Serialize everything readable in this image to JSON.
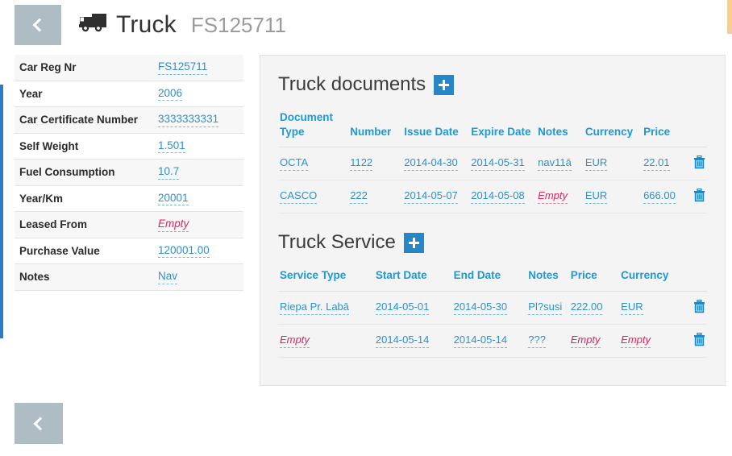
{
  "header": {
    "back_label": "",
    "back_icon": "chevron-left-icon",
    "truck_icon": "truck-icon",
    "title": "Truck",
    "subtitle": "FS125711"
  },
  "colors": {
    "accent_blue": "#2686c8",
    "header_link_blue": "#1a9ad9",
    "value_blue": "#2f8fd0",
    "empty_red": "#e0245e",
    "back_button_gray": "#aebcc4",
    "panel_bg": "#f4f4f4",
    "rail_blue": "#2b7cc4",
    "marker_orange": "#f6cf95"
  },
  "details": {
    "rows": [
      {
        "label": "Car Reg Nr",
        "value": "FS125711",
        "empty": false
      },
      {
        "label": "Year",
        "value": "2006",
        "empty": false
      },
      {
        "label": "Car Certificate Number",
        "value": "3333333331",
        "empty": false
      },
      {
        "label": "Self Weight",
        "value": "1.501",
        "empty": false
      },
      {
        "label": "Fuel Consumption",
        "value": "10.7",
        "empty": false
      },
      {
        "label": "Year/Km",
        "value": "20001",
        "empty": false
      },
      {
        "label": "Leased From",
        "value": "Empty",
        "empty": true
      },
      {
        "label": "Purchase Value",
        "value": "120001.00",
        "empty": false
      },
      {
        "label": "Notes",
        "value": "Nav",
        "empty": false
      }
    ]
  },
  "documents": {
    "title": "Truck documents",
    "add_label": "+",
    "columns": [
      "Document Type",
      "Number",
      "Issue Date",
      "Expire Date",
      "Notes",
      "Currency",
      "Price"
    ],
    "rows": [
      {
        "cells": [
          {
            "text": "OCTA",
            "empty": false
          },
          {
            "text": "1122",
            "empty": false
          },
          {
            "text": "2014-04-30",
            "empty": false
          },
          {
            "text": "2014-05-31",
            "empty": false
          },
          {
            "text": "nav11ā",
            "empty": false
          },
          {
            "text": "EUR",
            "empty": false
          },
          {
            "text": "22.01",
            "empty": false
          }
        ],
        "delete_icon": "trash-icon"
      },
      {
        "cells": [
          {
            "text": "CASCO",
            "empty": false
          },
          {
            "text": "222",
            "empty": false
          },
          {
            "text": "2014-05-07",
            "empty": false
          },
          {
            "text": "2014-05-08",
            "empty": false
          },
          {
            "text": "Empty",
            "empty": true
          },
          {
            "text": "EUR",
            "empty": false
          },
          {
            "text": "666.00",
            "empty": false
          }
        ],
        "delete_icon": "trash-icon"
      }
    ]
  },
  "service": {
    "title": "Truck Service",
    "add_label": "+",
    "columns": [
      "Service Type",
      "Start Date",
      "End Date",
      "Notes",
      "Price",
      "Currency"
    ],
    "rows": [
      {
        "cells": [
          {
            "text": "Riepa Pr. Labā",
            "empty": false
          },
          {
            "text": "2014-05-01",
            "empty": false
          },
          {
            "text": "2014-05-30",
            "empty": false
          },
          {
            "text": "Pl?susi",
            "empty": false
          },
          {
            "text": "222.00",
            "empty": false
          },
          {
            "text": "EUR",
            "empty": false
          }
        ],
        "delete_icon": "trash-icon"
      },
      {
        "cells": [
          {
            "text": "Empty",
            "empty": true
          },
          {
            "text": "2014-05-14",
            "empty": false
          },
          {
            "text": "2014-05-14",
            "empty": false
          },
          {
            "text": "???",
            "empty": false
          },
          {
            "text": "Empty",
            "empty": true
          },
          {
            "text": "Empty",
            "empty": true
          }
        ],
        "delete_icon": "trash-icon"
      }
    ]
  },
  "footer": {
    "back_icon": "chevron-left-icon"
  }
}
